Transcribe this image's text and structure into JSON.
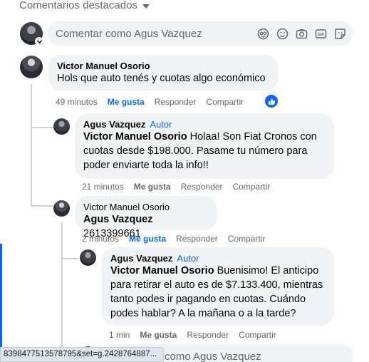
{
  "header": {
    "title": "Comentarios destacados"
  },
  "composer": {
    "placeholder": "Comentar como Agus Vazquez",
    "icons": [
      "avatar-sticker-icon",
      "emoji-icon",
      "camera-icon",
      "gif-icon",
      "sticker-icon"
    ]
  },
  "comments": [
    {
      "author": "Victor Manuel Osorio",
      "text": "Hols que auto tenés y cuotas algo económico",
      "time": "49 minutos",
      "like": "Me gusta",
      "reply": "Responder",
      "share": "Compartir"
    },
    {
      "author": "Agus Vazquez",
      "badge": "Autor",
      "mention": "Victor Manuel Osorio",
      "text": " Holaa! Son Fiat Cronos con cuotas desde $198.000. Pasame tu número para poder enviarte toda la info!!",
      "time": "21 minutos",
      "like": "Me gusta",
      "reply": "Responder",
      "share": "Compartir"
    },
    {
      "author": "Victor Manuel Osorio",
      "mention": "Agus Vazquez",
      "text": " 2613399661",
      "time": "2 minutos",
      "like": "Me gusta",
      "reply": "Responder",
      "share": "Compartir"
    },
    {
      "author": "Agus Vazquez",
      "badge": "Autor",
      "mention": "Victor Manuel Osorio",
      "text": " Buenisimo! El anticipo para retirar el auto es de $7.133.400, mientras tanto podes ir pagando en cuotas. Cuándo podes hablar? A la mañana o a la tarde?",
      "time": "1 min",
      "like": "Me gusta",
      "reply": "Responder",
      "share": "Compartir"
    }
  ],
  "bottom_composer": {
    "placeholder_partial": "como Agus Vazquez"
  },
  "statusbar": {
    "url": "8398477513578795&set=g.2428764887..."
  },
  "colors": {
    "accent": "#0866ff",
    "bubble": "#f0f2f5",
    "muted": "#65676b"
  }
}
